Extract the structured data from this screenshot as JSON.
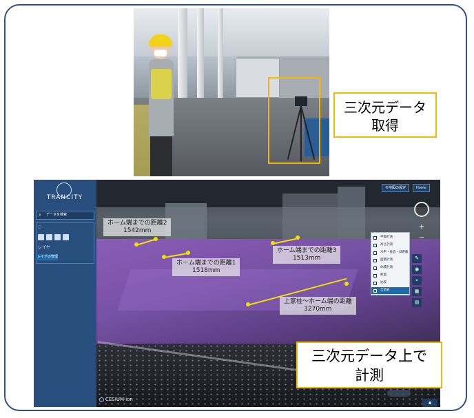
{
  "callouts": {
    "top": [
      "三次元データ",
      "取得"
    ],
    "bottom": [
      "三次元データ上で",
      "計測"
    ]
  },
  "app": {
    "logo": "TRANCITY",
    "search_label": "データを検索",
    "sidebar_layer_label": "レイヤ",
    "sidebar_layer_button": "レイヤの管理",
    "top_buttons": [
      "©地図の設定",
      "Home"
    ],
    "measurements": [
      {
        "label": "ホーム端までの距離2",
        "value": "1542mm"
      },
      {
        "label": "ホーム端までの距離1",
        "value": "1518mm"
      },
      {
        "label": "ホーム端までの距離3",
        "value": "1513mm"
      },
      {
        "label": "上家柱～ホーム端の距離",
        "value": "3270mm"
      }
    ],
    "menu_items": [
      "平面計測",
      "高さ計測",
      "水平・垂直・斜距離",
      "面積計測",
      "体積計測",
      "断面",
      "比較",
      "全消去"
    ],
    "menu_active_index": 7,
    "footer_logo": "CESIUM ion",
    "zoom_in": "+",
    "zoom_out": "−"
  }
}
